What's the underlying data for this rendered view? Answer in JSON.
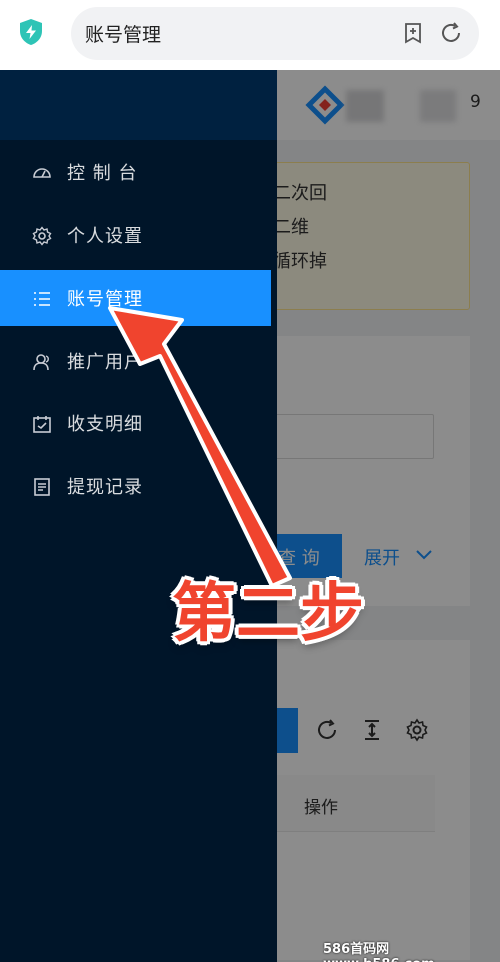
{
  "browser": {
    "address_text": "账号管理",
    "icons": [
      "shield-icon",
      "bookmark-add-icon",
      "refresh-icon"
    ]
  },
  "background_app": {
    "header_number": "9",
    "notice_lines": [
      "必掉线一次，二次回",
      "登录按钮请求二维",
      "登录，会一直循环掉"
    ],
    "query_button": "查 询",
    "expand_link": "展开",
    "table_header": "操作"
  },
  "sidebar": {
    "items": [
      {
        "label": "控 制 台",
        "icon": "dashboard-icon",
        "active": false
      },
      {
        "label": "个人设置",
        "icon": "gear-icon",
        "active": false
      },
      {
        "label": "账号管理",
        "icon": "list-icon",
        "active": true
      },
      {
        "label": "推广用户",
        "icon": "users-icon",
        "active": false
      },
      {
        "label": "收支明细",
        "icon": "calendar-icon",
        "active": false
      },
      {
        "label": "提现记录",
        "icon": "document-icon",
        "active": false
      }
    ]
  },
  "annotation": {
    "step_text": "第二步",
    "color": "#f0442e"
  },
  "watermark": "586首码网 www.h586.com",
  "colors": {
    "sidebar_bg": "#001529",
    "active_item": "#1890ff",
    "shield": "#2ec4b6"
  }
}
